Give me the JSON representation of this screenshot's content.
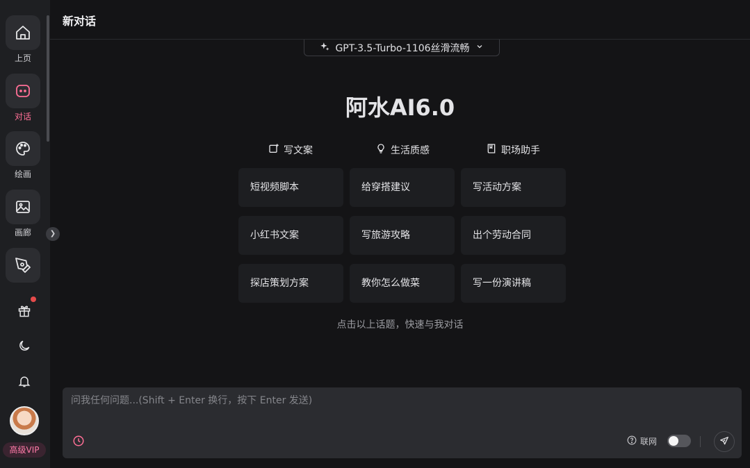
{
  "sidebar": {
    "nav": [
      {
        "label": "上页",
        "icon": "home-icon"
      },
      {
        "label": "对话",
        "icon": "chat-icon"
      },
      {
        "label": "绘画",
        "icon": "palette-icon"
      },
      {
        "label": "画廊",
        "icon": "image-icon"
      },
      {
        "label": "",
        "icon": "pen-tool-icon"
      }
    ],
    "extra_icons": [
      "gift-icon",
      "moon-icon",
      "bell-icon"
    ],
    "vip_label": "高级VIP"
  },
  "header": {
    "title": "新对话",
    "model": "GPT-3.5-Turbo-1106丝滑流畅"
  },
  "main": {
    "brand": "阿水AI6.0",
    "categories": [
      {
        "label": "写文案",
        "icon": "edit-icon"
      },
      {
        "label": "生活质感",
        "icon": "lightbulb-icon"
      },
      {
        "label": "职场助手",
        "icon": "book-icon"
      }
    ],
    "cards": [
      "短视频脚本",
      "给穿搭建议",
      "写活动方案",
      "小红书文案",
      "写旅游攻略",
      "出个劳动合同",
      "探店策划方案",
      "教你怎么做菜",
      "写一份演讲稿"
    ],
    "hint": "点击以上话题，快速与我对话"
  },
  "input": {
    "placeholder": "问我任何问题...(Shift + Enter 换行，按下 Enter 发送)",
    "web_label": "联网"
  },
  "colors": {
    "accent": "#ff6f96",
    "background": "#141416",
    "sidebar": "#1e1f22",
    "card": "#1d1e21"
  }
}
